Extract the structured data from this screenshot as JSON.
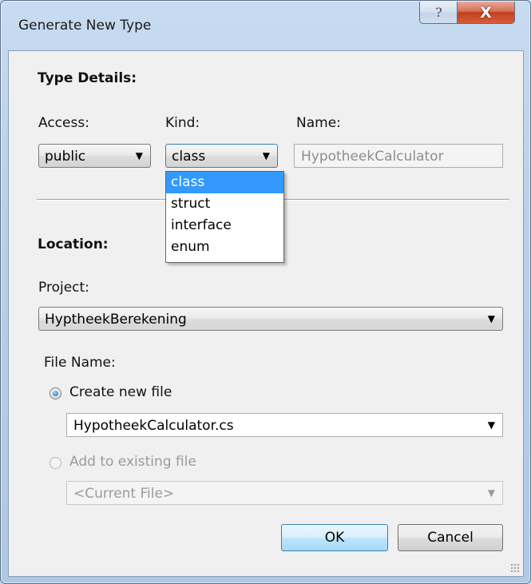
{
  "window": {
    "title": "Generate New Type",
    "help_glyph": "?",
    "close_glyph": "X"
  },
  "type_details": {
    "heading": "Type Details:",
    "access_label": "Access:",
    "kind_label": "Kind:",
    "name_label": "Name:",
    "access_value": "public",
    "kind_value": "class",
    "name_value": "HypotheekCalculator"
  },
  "kind_dropdown": {
    "options": [
      "class",
      "struct",
      "interface",
      "enum"
    ],
    "selected": "class"
  },
  "location": {
    "heading": "Location:",
    "project_label": "Project:",
    "project_value": "HyptheekBerekening",
    "file_name_label": "File Name:",
    "create_new_label": "Create new file",
    "create_new_value": "HypotheekCalculator.cs",
    "add_existing_label": "Add to existing file",
    "existing_value": "<Current File>"
  },
  "buttons": {
    "ok": "OK",
    "cancel": "Cancel"
  },
  "icons": {
    "dropdown": "chevron-down-icon",
    "help": "help-icon",
    "close": "close-icon"
  }
}
